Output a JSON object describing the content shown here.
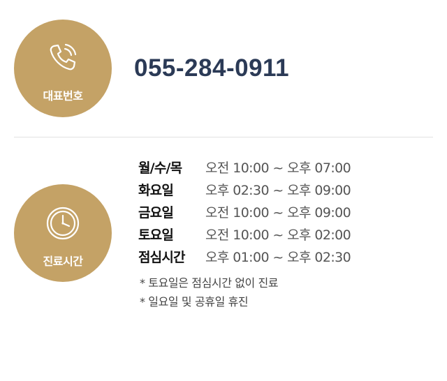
{
  "phone": {
    "label": "대표번호",
    "number": "055-284-0911",
    "icon": "phone-icon"
  },
  "hours": {
    "label": "진료시간",
    "icon": "clock-icon",
    "rows": [
      {
        "day": "월/수/목",
        "time": "오전 10:00 ~ 오후 07:00"
      },
      {
        "day": "화요일",
        "time": "오후 02:30 ~ 오후 09:00"
      },
      {
        "day": "금요일",
        "time": "오전 10:00 ~ 오후 09:00"
      },
      {
        "day": "토요일",
        "time": "오전 10:00 ~ 오후 02:00"
      },
      {
        "day": "점심시간",
        "time": "오후 01:00 ~ 오후 02:30"
      }
    ],
    "notes": [
      "* 토요일은 점심시간 없이 진료",
      "* 일요일 및 공휴일 휴진"
    ]
  },
  "colors": {
    "accent": "#c4a266",
    "phone_text": "#2b3a56"
  }
}
